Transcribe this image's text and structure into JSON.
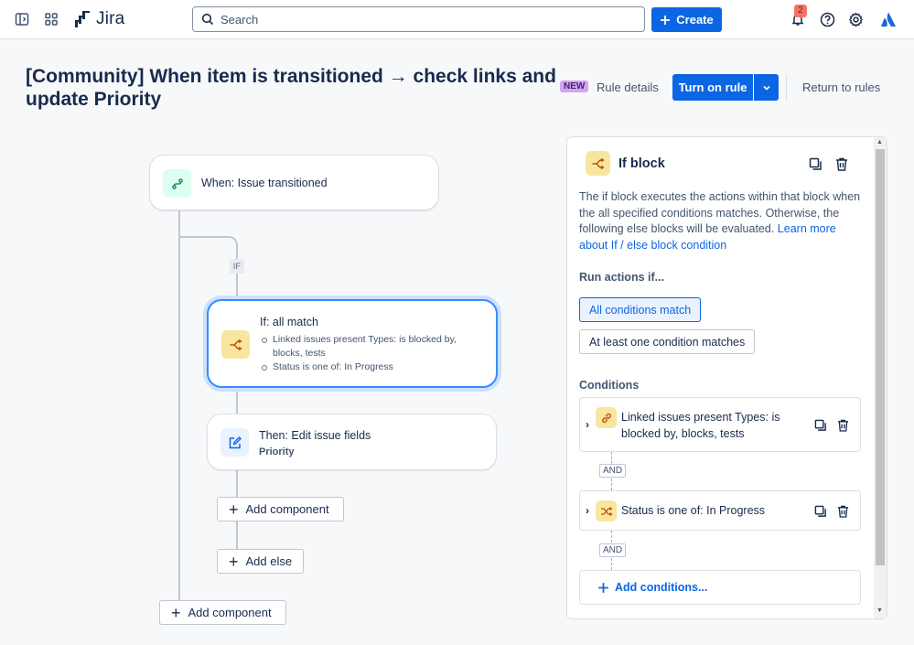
{
  "nav": {
    "app_name": "Jira",
    "search_placeholder": "Search",
    "create_label": "Create",
    "notification_count": "2"
  },
  "header": {
    "title": "[Community] When item is transitioned → check links and update Priority",
    "new_lozenge": "NEW",
    "rule_details": "Rule details",
    "turn_on": "Turn on rule",
    "return": "Return to rules"
  },
  "canvas": {
    "trigger": "When: Issue transitioned",
    "if_label": "IF",
    "condition_node": {
      "title": "If: all match",
      "bullets": [
        "Linked issues present Types: is blocked by, blocks, tests",
        "Status is one of: In Progress"
      ]
    },
    "action_node": {
      "title": "Then: Edit issue fields",
      "subtitle": "Priority"
    },
    "add_component_inner": "Add component",
    "add_else": "Add else",
    "add_component_outer": "Add component"
  },
  "panel": {
    "title": "If block",
    "description": "The if block executes the actions within that block when the all specified conditions matches. Otherwise, the following else blocks will be evaluated.",
    "learn_more": "Learn more about If / else block condition",
    "run_label": "Run actions if...",
    "option_all": "All conditions match",
    "option_one": "At least one condition matches",
    "conditions_label": "Conditions",
    "conditions": [
      {
        "text": "Linked issues present Types: is blocked by, blocks, tests"
      },
      {
        "text": "Status is one of: In Progress"
      }
    ],
    "and_label": "AND",
    "add_conditions": "Add conditions..."
  },
  "colors": {
    "primary": "#0c66e4",
    "selected_bg": "#e9f2ff",
    "icon_yellow": "#f8e6a0",
    "icon_green": "#dcfff1",
    "icon_blue": "#e9f2ff",
    "badge": "#f87168",
    "lozenge": "#d8a0f7"
  }
}
